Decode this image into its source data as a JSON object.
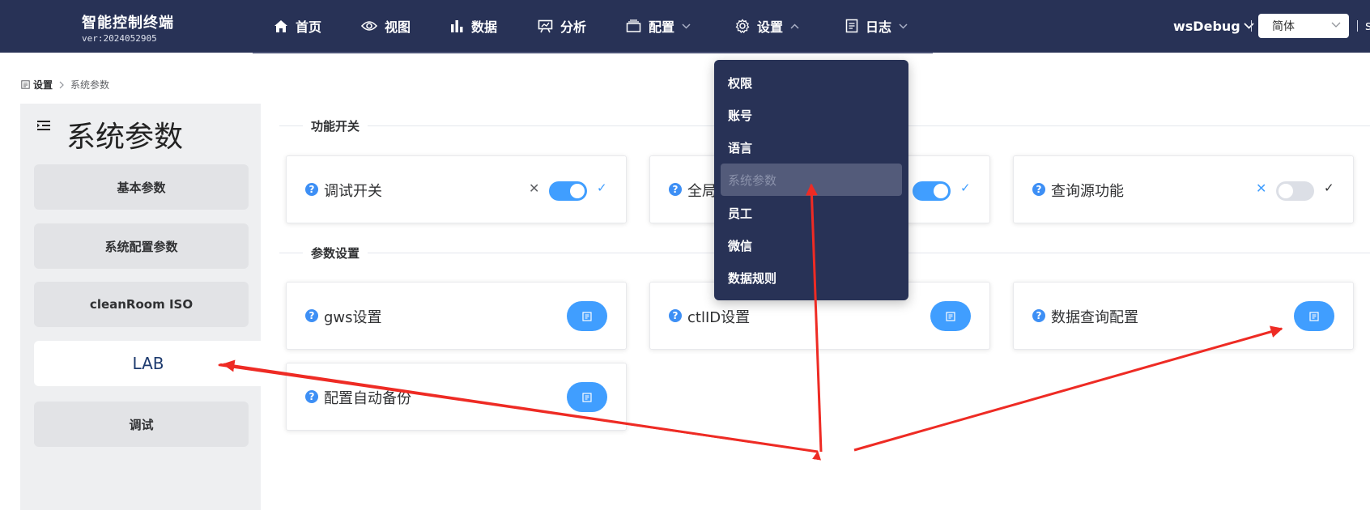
{
  "brand": {
    "title": "智能控制终端",
    "version": "ver:2024052905"
  },
  "nav": {
    "items": [
      {
        "label": "首页",
        "icon": "home-icon"
      },
      {
        "label": "视图",
        "icon": "eye-icon"
      },
      {
        "label": "数据",
        "icon": "bar-chart-icon"
      },
      {
        "label": "分析",
        "icon": "presentation-icon"
      },
      {
        "label": "配置",
        "icon": "layers-icon"
      },
      {
        "label": "设置",
        "icon": "gear-icon"
      },
      {
        "label": "日志",
        "icon": "document-icon"
      }
    ],
    "user": "wsDebug",
    "language": "简体",
    "extra": "s"
  },
  "breadcrumb": {
    "root": "设置",
    "current": "系统参数"
  },
  "sidebar": {
    "title": "系统参数",
    "items": [
      {
        "label": "基本参数"
      },
      {
        "label": "系统配置参数"
      },
      {
        "label": "cleanRoom ISO"
      },
      {
        "label": "LAB"
      },
      {
        "label": "调试"
      }
    ],
    "active_index": 3
  },
  "sections": {
    "features": {
      "label": "功能开关",
      "cards": [
        {
          "title": "调试开关",
          "enabled": true
        },
        {
          "title": "全局",
          "enabled": true
        },
        {
          "title": "查询源功能",
          "enabled": false
        }
      ]
    },
    "params": {
      "label": "参数设置",
      "cards": [
        {
          "title": "gws设置"
        },
        {
          "title": "ctlID设置"
        },
        {
          "title": "数据查询配置"
        },
        {
          "title": "配置自动备份"
        }
      ]
    }
  },
  "dropdown": {
    "items": [
      {
        "label": "权限"
      },
      {
        "label": "账号"
      },
      {
        "label": "语言"
      },
      {
        "label": "系统参数"
      },
      {
        "label": "员工"
      },
      {
        "label": "微信"
      },
      {
        "label": "数据规则"
      }
    ],
    "active_index": 3
  },
  "colors": {
    "header_bg": "#283256",
    "accent": "#409eff",
    "annotation": "#ee2b24"
  }
}
